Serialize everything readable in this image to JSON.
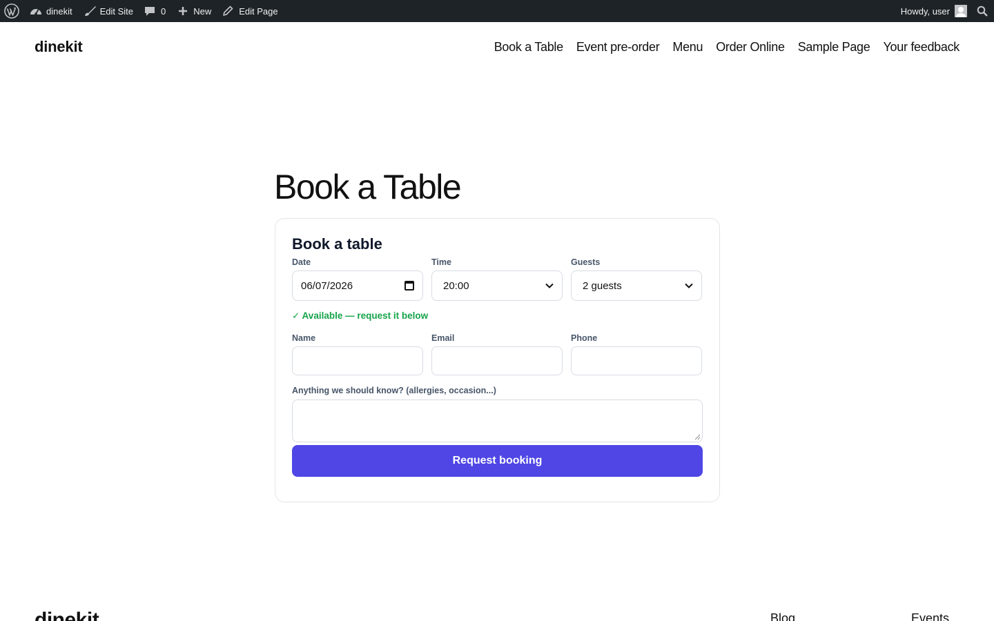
{
  "admin_bar": {
    "site_name": "dinekit",
    "edit_site": "Edit Site",
    "comments_count": "0",
    "new_label": "New",
    "edit_page": "Edit Page",
    "howdy": "Howdy, user"
  },
  "header": {
    "site_title": "dinekit",
    "nav": [
      "Book a Table",
      "Event pre-order",
      "Menu",
      "Order Online",
      "Sample Page",
      "Your feedback"
    ]
  },
  "page": {
    "title": "Book a Table"
  },
  "form": {
    "title": "Book a table",
    "date_label": "Date",
    "date_value": "06/07/2026",
    "time_label": "Time",
    "time_value": "20:00",
    "guests_label": "Guests",
    "guests_value": "2 guests",
    "availability": "✓ Available — request it below",
    "name_label": "Name",
    "email_label": "Email",
    "phone_label": "Phone",
    "notes_label": "Anything we should know? (allergies, occasion...)",
    "submit_label": "Request booking"
  },
  "footer": {
    "site_title": "dinekit",
    "links": [
      "Blog",
      "Events"
    ]
  },
  "colors": {
    "admin_bar_bg": "#1d2327",
    "accent": "#4f46e5",
    "available": "#16a34a"
  }
}
